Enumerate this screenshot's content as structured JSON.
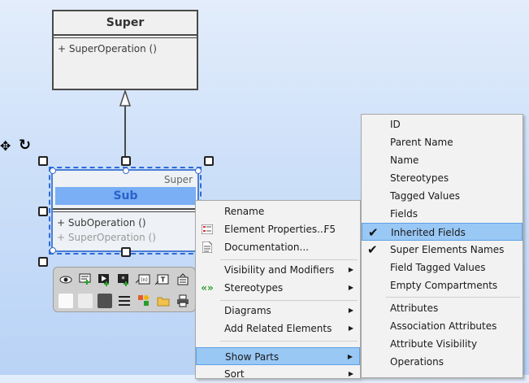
{
  "super_class": {
    "name": "Super",
    "operation": "+ SuperOperation ()"
  },
  "sub_class": {
    "stereotype": "Super",
    "name": "Sub",
    "operation": "+ SubOperation ()",
    "inherited_operation": "+ SuperOperation ()"
  },
  "context_menu": {
    "items": [
      {
        "label": "Rename"
      },
      {
        "label": "Element Properties...",
        "shortcut": "F5",
        "icon": "properties-icon"
      },
      {
        "label": "Documentation...",
        "icon": "document-icon"
      },
      {
        "label": "Visibility and Modifiers",
        "submenu": true
      },
      {
        "label": "Stereotypes",
        "submenu": true,
        "icon": "stereotype-icon"
      },
      {
        "label": "Diagrams",
        "submenu": true
      },
      {
        "label": "Add Related Elements",
        "submenu": true
      },
      {
        "label": "Show Parts",
        "submenu": true,
        "highlighted": true
      },
      {
        "label": "Sort",
        "submenu": true
      }
    ]
  },
  "show_parts_menu": {
    "items": [
      {
        "label": "ID",
        "checked": false
      },
      {
        "label": "Parent Name",
        "checked": false
      },
      {
        "label": "Name",
        "checked": false
      },
      {
        "label": "Stereotypes",
        "checked": false
      },
      {
        "label": "Tagged Values",
        "checked": false
      },
      {
        "label": "Fields",
        "checked": false
      },
      {
        "label": "Inherited Fields",
        "checked": true,
        "highlighted": true
      },
      {
        "label": "Super Elements Names",
        "checked": true
      },
      {
        "label": "Field Tagged Values",
        "checked": false
      },
      {
        "label": "Empty Compartments",
        "checked": false
      },
      {
        "label": "Attributes",
        "checked": false
      },
      {
        "label": "Association Attributes",
        "checked": false
      },
      {
        "label": "Attribute Visibility",
        "checked": false
      },
      {
        "label": "Operations",
        "checked": false
      }
    ],
    "check_glyph": "✔"
  },
  "toolbar": {
    "icons": [
      "eye-icon",
      "comment-add-icon",
      "run-add-icon",
      "star-add-icon",
      "value-icon",
      "text-icon",
      "stack-icon",
      "fill-white-icon",
      "fill-light-icon",
      "fill-dark-icon",
      "line-style-icon",
      "shape-style-icon",
      "folder-icon",
      "printer-icon"
    ]
  },
  "colors": {
    "selection": "#2f6bd8",
    "highlight": "#99c8f5",
    "sub_name_fill": "#7aaef5"
  }
}
